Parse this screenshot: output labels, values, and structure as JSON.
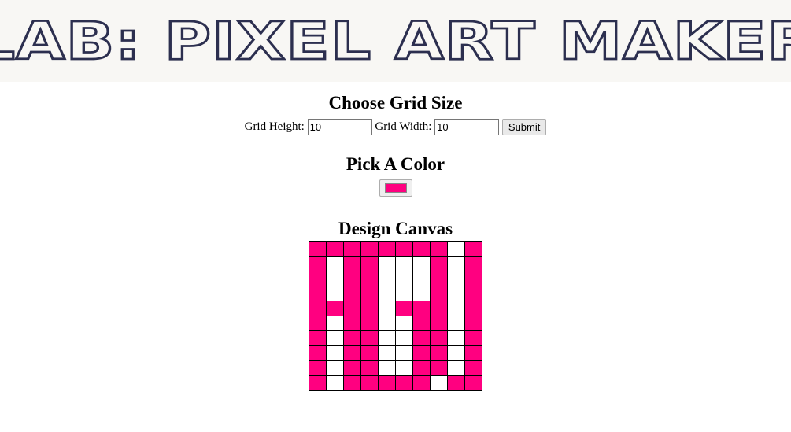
{
  "header": {
    "title": "LAB: PIXEL ART MAKER"
  },
  "grid_size": {
    "title": "Choose Grid Size",
    "height_label": "Grid Height:",
    "height_value": "10",
    "width_label": "Grid Width:",
    "width_value": "10",
    "submit_label": "Submit"
  },
  "color": {
    "title": "Pick A Color",
    "selected": "#ff0080"
  },
  "canvas": {
    "title": "Design Canvas",
    "rows": 10,
    "cols": 10,
    "fill_color": "#ff0080",
    "pixels": [
      [
        1,
        1,
        1,
        1,
        1,
        1,
        1,
        1,
        0,
        1
      ],
      [
        1,
        0,
        1,
        1,
        0,
        0,
        0,
        1,
        0,
        1
      ],
      [
        1,
        0,
        1,
        1,
        0,
        0,
        0,
        1,
        0,
        1
      ],
      [
        1,
        0,
        1,
        1,
        0,
        0,
        0,
        1,
        0,
        1
      ],
      [
        1,
        1,
        1,
        1,
        0,
        1,
        1,
        1,
        0,
        1
      ],
      [
        1,
        0,
        1,
        1,
        0,
        0,
        1,
        1,
        0,
        1
      ],
      [
        1,
        0,
        1,
        1,
        0,
        0,
        1,
        1,
        0,
        1
      ],
      [
        1,
        0,
        1,
        1,
        0,
        0,
        1,
        1,
        0,
        1
      ],
      [
        1,
        0,
        1,
        1,
        0,
        0,
        1,
        1,
        0,
        1
      ],
      [
        1,
        0,
        1,
        1,
        1,
        1,
        1,
        0,
        1,
        1
      ]
    ]
  }
}
